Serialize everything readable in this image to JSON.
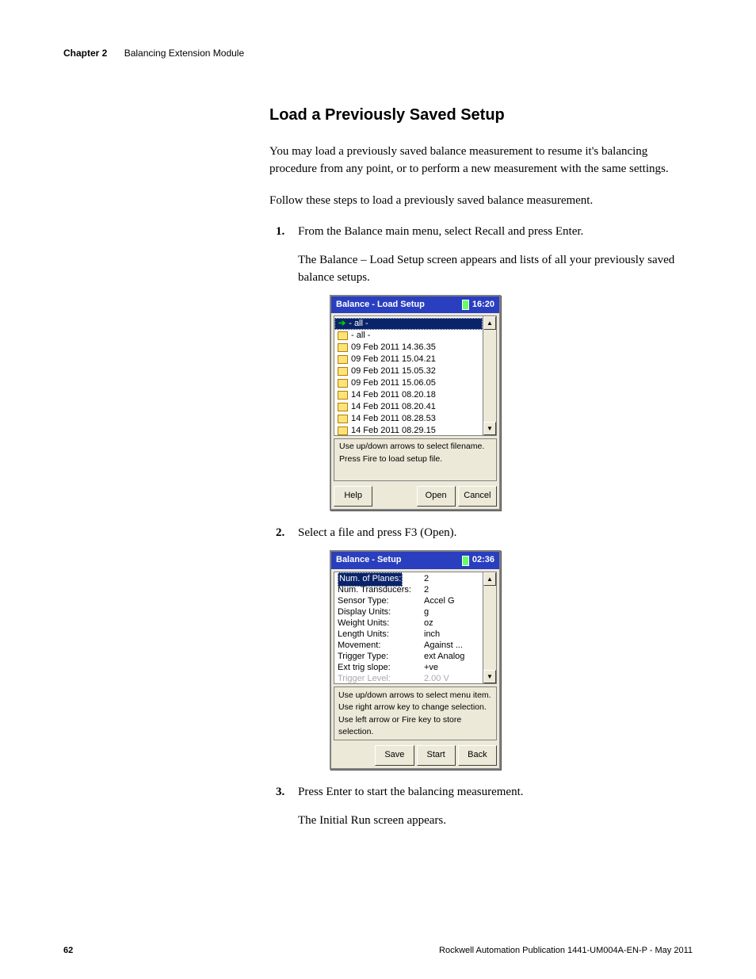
{
  "header": {
    "chapter": "Chapter 2",
    "title": "Balancing Extension Module"
  },
  "section": {
    "heading": "Load a Previously Saved Setup",
    "para1": "You may load a previously saved balance measurement to resume it's balancing procedure from any point, or to perform a new measurement with the same settings.",
    "para2": "Follow these steps to load a previously saved balance measurement."
  },
  "steps": {
    "s1": {
      "num": "1.",
      "text": "From the Balance main menu, select Recall and press Enter.",
      "sub": "The Balance – Load Setup screen appears and lists of all your previously saved balance setups."
    },
    "s2": {
      "num": "2.",
      "text": "Select a file and press F3 (Open)."
    },
    "s3": {
      "num": "3.",
      "text": "Press Enter to start the balancing measurement.",
      "sub": "The Initial Run screen appears."
    }
  },
  "device1": {
    "title": "Balance - Load Setup",
    "clock": "16:20",
    "items": {
      "i0": "- all -",
      "i1": "- all -",
      "i2": "09 Feb 2011 14.36.35",
      "i3": "09 Feb 2011 15.04.21",
      "i4": "09 Feb 2011 15.05.32",
      "i5": "09 Feb 2011 15.06.05",
      "i6": "14 Feb 2011 08.20.18",
      "i7": "14 Feb 2011 08.20.41",
      "i8": "14 Feb 2011 08.28.53",
      "i9": "14 Feb 2011 08.29.15"
    },
    "info1": "Use up/down arrows to select filename.",
    "info2": "Press Fire to load setup file.",
    "btn_help": "Help",
    "btn_open": "Open",
    "btn_cancel": "Cancel"
  },
  "device2": {
    "title": "Balance - Setup",
    "clock": "02:36",
    "rows": {
      "r0": {
        "lbl": "Num. of Planes:",
        "val": "2"
      },
      "r1": {
        "lbl": "Num. Transducers:",
        "val": "2"
      },
      "r2": {
        "lbl": "Sensor Type:",
        "val": "Accel G"
      },
      "r3": {
        "lbl": "Display Units:",
        "val": "g"
      },
      "r4": {
        "lbl": "Weight Units:",
        "val": "oz"
      },
      "r5": {
        "lbl": "Length Units:",
        "val": "inch"
      },
      "r6": {
        "lbl": "Movement:",
        "val": "Against ..."
      },
      "r7": {
        "lbl": "Trigger Type:",
        "val": "ext Analog"
      },
      "r8": {
        "lbl": "Ext trig slope:",
        "val": "+ve"
      },
      "r9": {
        "lbl": "Trigger Level:",
        "val": "2.00 V"
      }
    },
    "info1": "Use up/down arrows to select menu item.",
    "info2": "Use right arrow key to change selection.",
    "info3": "Use left arrow or Fire key to store selection.",
    "btn_save": "Save",
    "btn_start": "Start",
    "btn_back": "Back"
  },
  "footer": {
    "page": "62",
    "pub": "Rockwell Automation Publication 1441-UM004A-EN-P - May 2011"
  }
}
